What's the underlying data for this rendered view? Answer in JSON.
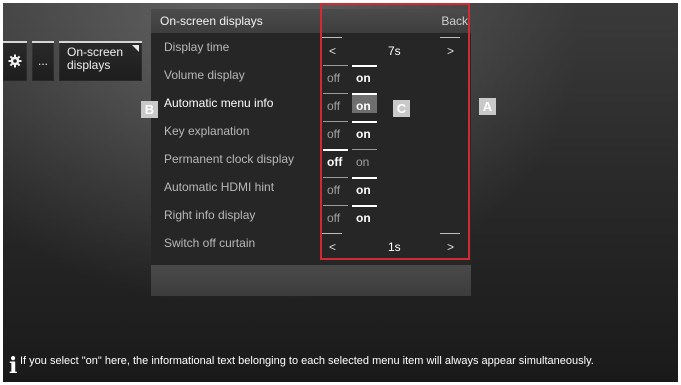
{
  "colors": {
    "callout_border": "#d12a33",
    "badge_bg": "#c9c9c9",
    "highlight": "#6f6f6f"
  },
  "left_tiles": {
    "gear_icon": "gear-icon",
    "more_label": "...",
    "osd_label": "On-screen\ndisplays"
  },
  "menu": {
    "title": "On-screen displays",
    "back_label": "Back",
    "rows": [
      {
        "label": "Display time",
        "type": "arrows",
        "left": "<",
        "value": "7s",
        "right": ">"
      },
      {
        "label": "Volume display",
        "type": "toggle",
        "off": "off",
        "on": "on",
        "selected": "on"
      },
      {
        "label": "Automatic menu info",
        "type": "toggle",
        "off": "off",
        "on": "on",
        "selected": "on",
        "focused": true
      },
      {
        "label": "Key explanation",
        "type": "toggle",
        "off": "off",
        "on": "on",
        "selected": "on"
      },
      {
        "label": "Permanent clock display",
        "type": "toggle",
        "off": "off",
        "on": "on",
        "selected": "off"
      },
      {
        "label": "Automatic HDMI hint",
        "type": "toggle",
        "off": "off",
        "on": "on",
        "selected": "on"
      },
      {
        "label": "Right info display",
        "type": "toggle",
        "off": "off",
        "on": "on",
        "selected": "on"
      },
      {
        "label": "Switch off curtain",
        "type": "arrows",
        "left": "<",
        "value": "1s",
        "right": ">"
      }
    ]
  },
  "callouts": {
    "a": "A",
    "b": "B",
    "c": "C"
  },
  "info": {
    "icon": "info-icon",
    "text": "If you select \"on\" here, the informational text belonging to each selected menu item will always appear simultaneously."
  }
}
